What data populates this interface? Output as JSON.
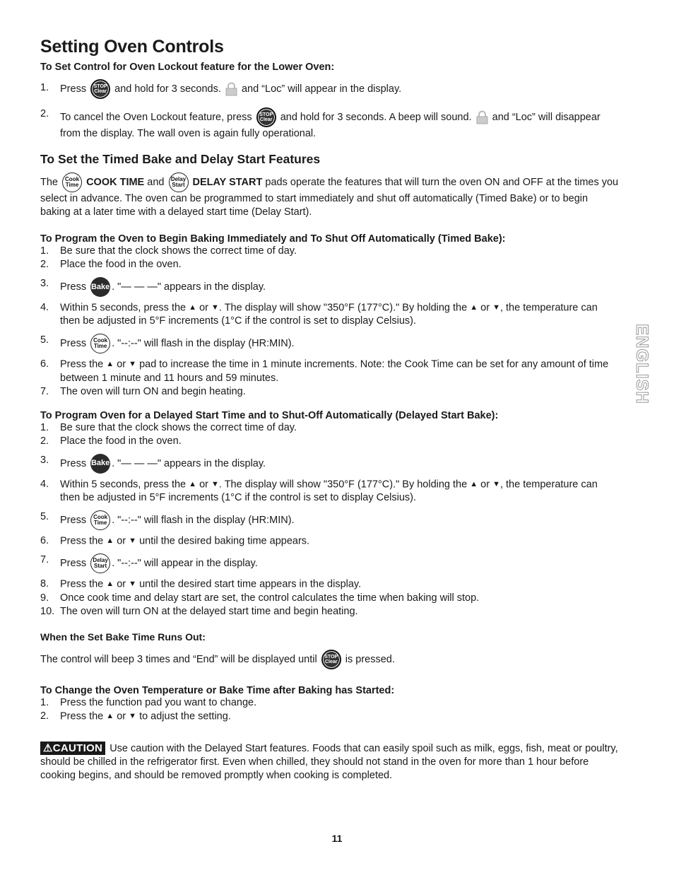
{
  "title": "Setting Oven Controls",
  "lockout": {
    "heading": "To Set Control for Oven Lockout feature for the Lower Oven:",
    "step1": {
      "num": "1.",
      "a": "Press",
      "b": "and hold for 3 seconds.",
      "c": "and “Loc” will appear in the display."
    },
    "step2": {
      "num": "2.",
      "a": "To cancel the Oven Lockout feature, press",
      "b": "and hold for 3 seconds. A beep will sound.",
      "c": "and “Loc” will disappear from the display. The wall oven is again fully operational."
    }
  },
  "pads": {
    "stop_top": "STOP",
    "stop_bottom": "Clear",
    "cook_top": "Cook",
    "cook_bottom": "Time",
    "delay_top": "Delay",
    "delay_bottom": "Start",
    "bake": "Bake"
  },
  "timed": {
    "heading": "To Set the Timed Bake and Delay Start Features",
    "intro_a": "The",
    "cook_time_label": "COOK TIME",
    "intro_b": "and",
    "delay_start_label": "DELAY START",
    "intro_c": "pads operate the features that will turn the oven ON and OFF at the times you select in advance. The oven can be programmed to start immediately and shut off automatically (Timed Bake) or to begin baking at a later time with a delayed start time (Delay Start)."
  },
  "timed_bake": {
    "heading": "To Program the Oven to Begin Baking Immediately and To Shut Off Automatically (Timed Bake):",
    "s1": {
      "num": "1.",
      "text": "Be sure that the clock shows the correct time of day."
    },
    "s2": {
      "num": "2.",
      "text": "Place the food in the oven."
    },
    "s3": {
      "num": "3.",
      "a": "Press",
      "b": ". \"— — —\" appears in the display."
    },
    "s4": {
      "num": "4.",
      "a": "Within 5 seconds, press the",
      "b": "or",
      "c": ". The display will show \"350°F (177°C).\" By holding the",
      "d": "or",
      "e": ", the temperature can then be adjusted in 5°F increments (1°C if the control is set to display Celsius)."
    },
    "s5": {
      "num": "5.",
      "a": "Press",
      "b": ". \"--:--\" will flash in the display (HR:MIN)."
    },
    "s6": {
      "num": "6.",
      "a": "Press the",
      "b": "or",
      "c": "pad to increase the time in 1 minute increments. Note: the Cook Time can be set for any amount of time between 1 minute and 11 hours and 59 minutes."
    },
    "s7": {
      "num": "7.",
      "text": "The oven will turn ON and begin heating."
    }
  },
  "delayed": {
    "heading": "To Program Oven for a Delayed Start Time and to Shut-Off Automatically (Delayed Start Bake):",
    "s1": {
      "num": "1.",
      "text": "Be sure that the clock shows the correct time of day."
    },
    "s2": {
      "num": "2.",
      "text": "Place the food in the oven."
    },
    "s3": {
      "num": "3.",
      "a": "Press",
      "b": ". \"— — —\" appears in the display."
    },
    "s4": {
      "num": "4.",
      "a": "Within 5 seconds, press the",
      "b": "or",
      "c": ". The display will show \"350°F (177°C).\" By holding the",
      "d": "or",
      "e": ", the temperature can then be adjusted in 5°F increments (1°C if the control is set to display Celsius)."
    },
    "s5": {
      "num": "5.",
      "a": "Press",
      "b": ". \"--:--\" will flash in the display (HR:MIN)."
    },
    "s6": {
      "num": "6.",
      "a": "Press the",
      "b": "or",
      "c": "until the desired baking time appears."
    },
    "s7": {
      "num": "7.",
      "a": "Press",
      "b": ". \"--:--\" will appear in the display."
    },
    "s8": {
      "num": "8.",
      "a": "Press the",
      "b": "or",
      "c": "until the desired start time appears in the display."
    },
    "s9": {
      "num": "9.",
      "text": "Once cook time and delay start are set, the control calculates the time when baking will stop."
    },
    "s10": {
      "num": "10.",
      "text": "The oven will turn ON at the delayed start time and begin heating."
    }
  },
  "runs_out": {
    "heading": "When the Set Bake Time Runs Out:",
    "a": "The control will beep 3 times and “End” will be displayed until",
    "b": "is pressed."
  },
  "change": {
    "heading": "To Change the Oven Temperature or Bake Time after Baking has Started:",
    "s1": {
      "num": "1.",
      "text": "Press the function pad you want to change."
    },
    "s2": {
      "num": "2.",
      "a": "Press the",
      "b": "or",
      "c": "to adjust the setting."
    }
  },
  "caution": {
    "badge": "CAUTION",
    "text": "Use caution with the Delayed Start features. Foods that can easily spoil such as milk, eggs, fish, meat or poultry, should be chilled in the refrigerator first. Even when chilled, they should not stand in the oven for more than 1 hour before cooking begins, and should be removed promptly when cooking is completed."
  },
  "side_tab": "ENGLISH",
  "page_number": "11",
  "icons": {
    "up": "▲",
    "down": "▼",
    "warning": "⚠"
  }
}
